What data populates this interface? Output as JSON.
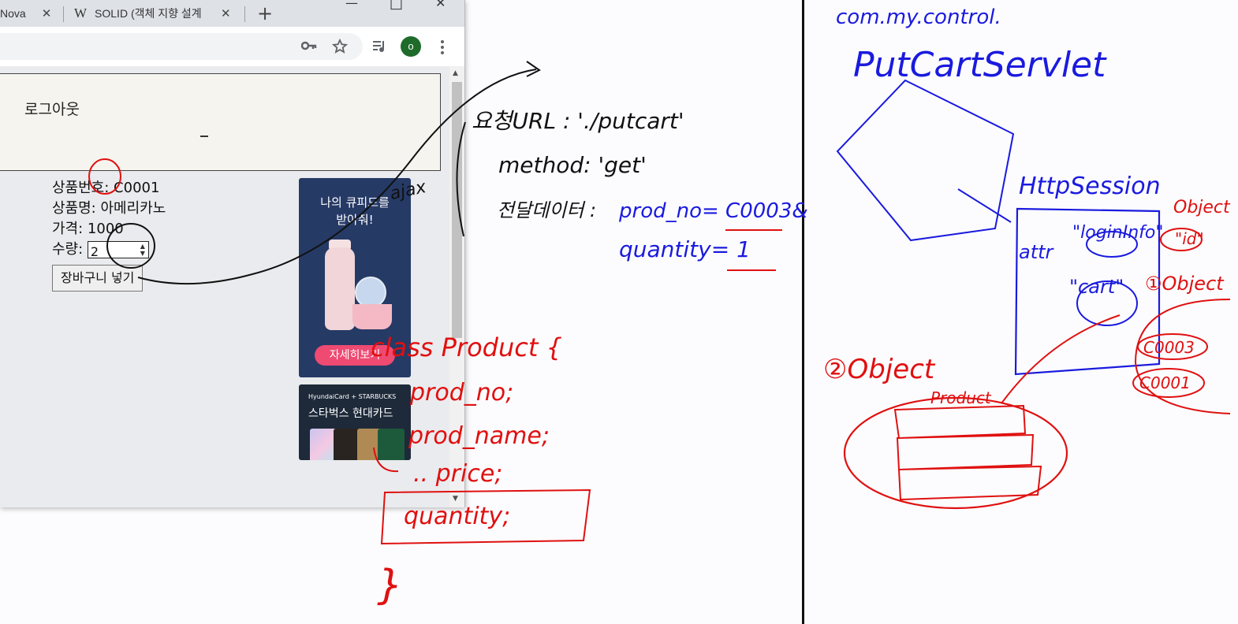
{
  "browser": {
    "tabs": [
      {
        "title": "Nova",
        "close": "✕"
      },
      {
        "favicon": "W",
        "title": "SOLID (객체 지향 설계",
        "close": "✕"
      }
    ],
    "new_tab": "+",
    "window_controls": {
      "minimize": "—",
      "maximize": "□",
      "close": "✕"
    },
    "toolbar_icons": [
      "key-icon",
      "star-icon",
      "media-icon",
      "menu-icon"
    ],
    "profile_initial": "o"
  },
  "page": {
    "logout": "로그아웃",
    "product": {
      "no_label": "상품번호:",
      "no_value": "C0001",
      "name_label": "상품명:",
      "name_value": "아메리카노",
      "price_label": "가격:",
      "price_value": "1000",
      "qty_label": "수량:",
      "qty_value": "2",
      "add_button": "장바구니 넣기"
    },
    "ad1": {
      "title_line1": "나의 큐피드를",
      "title_line2": "받아줘!",
      "button": "자세히보기"
    },
    "ad2": {
      "top": "HyundaiCard  +  STARBUCKS",
      "title": "스타벅스 현대카드"
    }
  },
  "whiteboard": {
    "package": "com.my.control.",
    "servlet": "PutCartServlet",
    "request_url": "요청URL : './putcart'",
    "method": "method: 'get'",
    "transfer_label": "전달데이터 :",
    "param1": "prod_no= C0003&",
    "param2": "quantity= 1",
    "ajax": "ajax",
    "session": "HttpSession",
    "attr": "attr",
    "loginInfo": "\"loginInfo\"",
    "id": "\"id\"",
    "object1": "Object",
    "cart": "\"cart\"",
    "object2": "①Object",
    "key1": "C0003",
    "key2": "C0001",
    "object3": "②Object",
    "product_label": "Product",
    "class_open": "class Product {",
    "field1": "prod_no;",
    "field2": "prod_name;",
    "field3": ".. price;",
    "field4": "quantity;",
    "class_close": "}",
    "colors": {
      "black": "#111111",
      "blue": "#1a1adf",
      "red": "#e01010"
    }
  }
}
